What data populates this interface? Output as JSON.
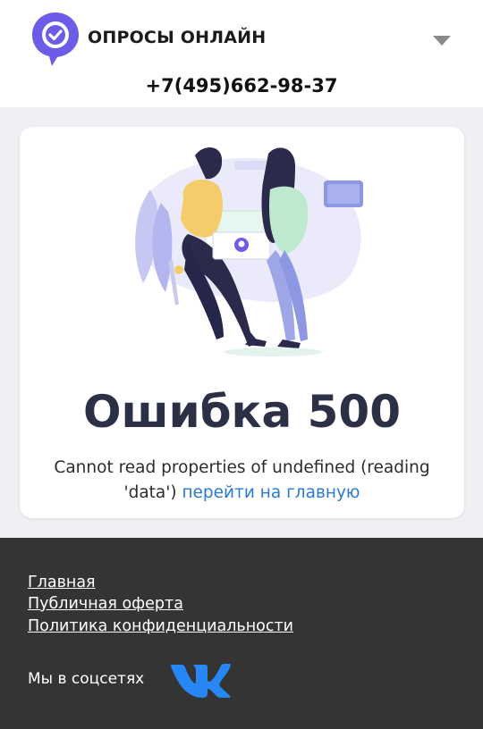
{
  "header": {
    "brand": "ОПРОСЫ ОНЛАЙН",
    "phone": "+7(495)662-98-37",
    "logo_icon": "checkmark-pin-icon",
    "menu_icon": "chevron-down-icon"
  },
  "error": {
    "title": "Ошибка 500",
    "message": "Cannot read properties of undefined (reading 'data')",
    "link_label": "перейти на главную"
  },
  "footer": {
    "links": [
      "Главная",
      "Публичная оферта",
      "Политика конфиденциальности"
    ],
    "social_label": "Мы в соцсетях",
    "social_icon": "vk-icon"
  },
  "colors": {
    "brand_purple": "#6c5ce7",
    "link_blue": "#2a7ad2",
    "footer_bg": "#343434",
    "page_bg": "#eef0f3",
    "vk_blue": "#2787f5"
  }
}
